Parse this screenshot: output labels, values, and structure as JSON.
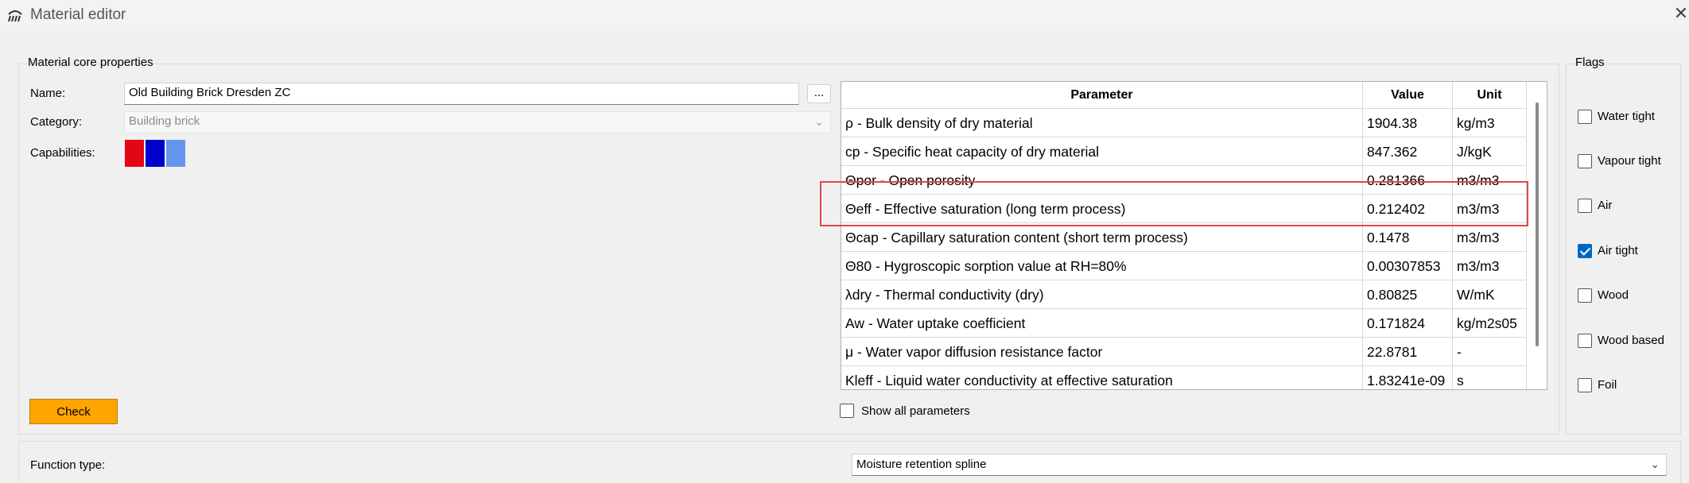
{
  "window": {
    "title": "Material editor",
    "close_glyph": "✕"
  },
  "core": {
    "group_title": "Material core properties",
    "name_label": "Name:",
    "name_value": "Old Building Brick Dresden ZC",
    "dots_label": "...",
    "category_label": "Category:",
    "category_value": "Building brick",
    "capabilities_label": "Capabilities:",
    "capability_colors": [
      "#e30613",
      "#0000cc",
      "#6495ed"
    ],
    "check_label": "Check"
  },
  "table": {
    "headers": [
      "Parameter",
      "Value",
      "Unit"
    ],
    "rows": [
      [
        "ρ - Bulk density of dry material",
        "1904.38",
        "kg/m3"
      ],
      [
        "cp - Specific heat capacity of dry material",
        "847.362",
        "J/kgK"
      ],
      [
        "Θpor - Open porosity",
        "0.281366",
        "m3/m3"
      ],
      [
        "Θeff - Effective saturation (long term process)",
        "0.212402",
        "m3/m3"
      ],
      [
        "Θcap - Capillary saturation content (short term process)",
        "0.1478",
        "m3/m3"
      ],
      [
        "Θ80 - Hygroscopic sorption value at RH=80%",
        "0.00307853",
        "m3/m3"
      ],
      [
        "λdry - Thermal conductivity (dry)",
        "0.80825",
        "W/mK"
      ],
      [
        "Aw - Water uptake coefficient",
        "0.171824",
        "kg/m2s05"
      ],
      [
        "μ - Water vapor diffusion resistance factor",
        "22.8781",
        "-"
      ],
      [
        "Kleff - Liquid water conductivity at effective saturation",
        "1.83241e-09",
        "s"
      ]
    ],
    "show_all_label": "Show all parameters",
    "highlight_color": "#e04848"
  },
  "flags": {
    "group_title": "Flags",
    "items": [
      {
        "label": "Water tight",
        "checked": false
      },
      {
        "label": "Vapour tight",
        "checked": false
      },
      {
        "label": "Air",
        "checked": false
      },
      {
        "label": "Air tight",
        "checked": true
      },
      {
        "label": "Wood",
        "checked": false
      },
      {
        "label": "Wood based",
        "checked": false
      },
      {
        "label": "Foil",
        "checked": false
      }
    ]
  },
  "function": {
    "label": "Function type:",
    "value": "Moisture retention spline"
  }
}
